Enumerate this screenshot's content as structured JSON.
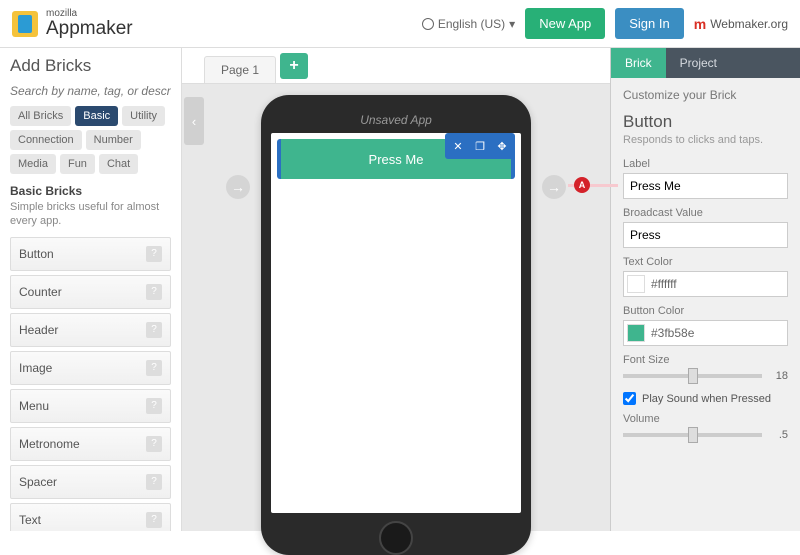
{
  "header": {
    "logo_small": "mozilla",
    "logo_big": "Appmaker",
    "language": "English (US)",
    "new_app": "New App",
    "sign_in": "Sign In",
    "webmaker": "Webmaker.org"
  },
  "tabs": {
    "page1": "Page 1"
  },
  "left": {
    "title": "Add Bricks",
    "search_placeholder": "Search by name, tag, or description...",
    "tags": {
      "all": "All Bricks",
      "basic": "Basic",
      "utility": "Utility",
      "connection": "Connection",
      "number": "Number",
      "media": "Media",
      "fun": "Fun",
      "chat": "Chat"
    },
    "category_title": "Basic Bricks",
    "category_desc": "Simple bricks useful for almost every app.",
    "bricks": {
      "button": "Button",
      "counter": "Counter",
      "header": "Header",
      "image": "Image",
      "menu": "Menu",
      "metronome": "Metronome",
      "spacer": "Spacer",
      "text": "Text"
    }
  },
  "phone": {
    "title": "Unsaved App",
    "button_label": "Press Me"
  },
  "badge": "A",
  "right": {
    "tab_brick": "Brick",
    "tab_project": "Project",
    "subtitle": "Customize your Brick",
    "component": "Button",
    "component_desc": "Responds to clicks and taps.",
    "label_field": "Label",
    "label_value": "Press Me",
    "broadcast_field": "Broadcast Value",
    "broadcast_value": "Press",
    "textcolor_field": "Text Color",
    "textcolor_value": "#ffffff",
    "buttoncolor_field": "Button Color",
    "buttoncolor_value": "#3fb58e",
    "fontsize_field": "Font Size",
    "fontsize_value": "18",
    "playsound_label": "Play Sound when Pressed",
    "volume_field": "Volume",
    "volume_value": ".5"
  }
}
